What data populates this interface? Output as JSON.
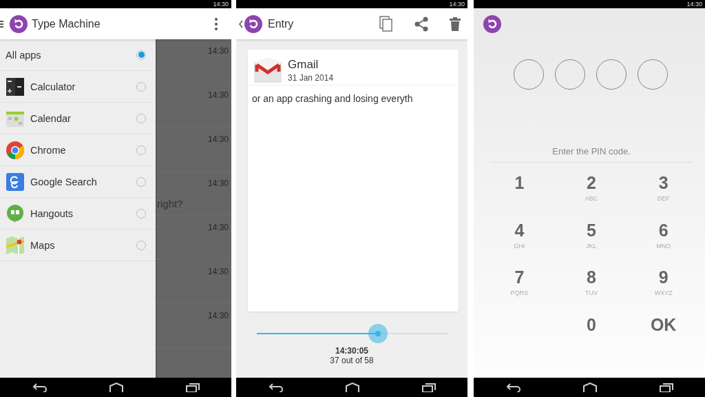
{
  "screens": [
    {
      "kind": "drawer",
      "status_time": "14:30",
      "app_bar": {
        "title": "Type Machine"
      },
      "filter_items": [
        {
          "label": "All apps",
          "selected": true
        },
        {
          "label": "Calculator",
          "selected": false
        },
        {
          "label": "Calendar",
          "selected": false
        },
        {
          "label": "Chrome",
          "selected": false
        },
        {
          "label": "Google Search",
          "selected": false
        },
        {
          "label": "Hangouts",
          "selected": false
        },
        {
          "label": "Maps",
          "selected": false
        }
      ],
      "background_rows": [
        {
          "time": "14:30"
        },
        {
          "time": "14:30"
        },
        {
          "time": "14:30"
        },
        {
          "time": "14:30",
          "text": "right?"
        },
        {
          "time": "14:30"
        },
        {
          "time": "14:30"
        },
        {
          "time": "14:30"
        }
      ]
    },
    {
      "kind": "entry",
      "status_time": "14:30",
      "app_bar": {
        "title": "Entry"
      },
      "entry": {
        "app": "Gmail",
        "date": "31 Jan 2014",
        "text": "or an app crashing and losing everyth"
      },
      "slider": {
        "level": 0.63
      },
      "time": "14:30:05",
      "position": "37 out of 58"
    },
    {
      "kind": "pin",
      "status_time": "14:30",
      "pin_slots": [
        {
          "filled": false
        },
        {
          "filled": false
        },
        {
          "filled": false
        },
        {
          "filled": false
        }
      ],
      "prompt": "Enter the PIN code.",
      "keys": [
        {
          "kind": "digit",
          "label": "1"
        },
        {
          "kind": "digit",
          "label": "2",
          "letters": "ABC"
        },
        {
          "kind": "digit",
          "label": "3",
          "letters": "DEF"
        },
        {
          "kind": "digit",
          "label": "4",
          "letters": "GHI"
        },
        {
          "kind": "digit",
          "label": "5",
          "letters": "JKL"
        },
        {
          "kind": "digit",
          "label": "6",
          "letters": "MNO"
        },
        {
          "kind": "digit",
          "label": "7",
          "letters": "PQRS"
        },
        {
          "kind": "digit",
          "label": "8",
          "letters": "TUV"
        },
        {
          "kind": "digit",
          "label": "9",
          "letters": "WXYZ"
        },
        {
          "kind": "digit",
          "label": "0"
        },
        {
          "kind": "ok",
          "label": "OK"
        }
      ]
    }
  ]
}
